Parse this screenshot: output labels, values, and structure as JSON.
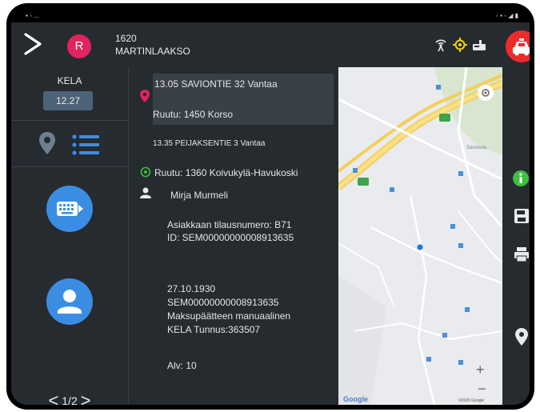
{
  "header": {
    "vehicle_id": "1620",
    "vehicle_name": "MARTINLAAKSO",
    "avatar_letter": "R"
  },
  "left_panel": {
    "kela_label": "KELA",
    "kela_time": "12.27",
    "pager": {
      "prev": "<",
      "page": "1/2",
      "next": ">"
    }
  },
  "trip": {
    "pickup_address": "13.05 SAVIONTIE 32 Vantaa",
    "pickup_zone": "Ruutu: 1450 Korso",
    "next_address": "13.35 PEIJAKSENTIE 3 Vantaa",
    "dropoff_zone": "Ruutu: 1360 Koivukylä-Havukoski",
    "customer_name": "Mirja Murmeli",
    "order_number": "Asiakkaan tilausnumero: B71",
    "order_id": "ID: SEM00000000008913635",
    "birth_date": "27.10.1930",
    "sem_id": "SEM00000000008913635",
    "payment_note": "Maksupäätteen manuaalinen",
    "kela_code": "KELA Tunnus:363507",
    "vat": "Alv: 10"
  },
  "map": {
    "place_label": "Savonula",
    "zoom_in": "+",
    "zoom_out": "−",
    "logo": "Google",
    "copyright": "©2020 Google"
  },
  "colors": {
    "background": "#262b30",
    "accent_blue": "#3b8de3",
    "pin_pink": "#e0245e",
    "car_red": "#ee2b2b",
    "green": "#3fbf3f"
  },
  "icons": [
    "chevron-right-icon",
    "antenna-icon",
    "gps-icon",
    "taxi-meter-icon",
    "car-icon",
    "location-pin-icon",
    "list-icon",
    "keyboard-icon",
    "person-icon",
    "info-icon",
    "save-icon",
    "print-icon"
  ]
}
